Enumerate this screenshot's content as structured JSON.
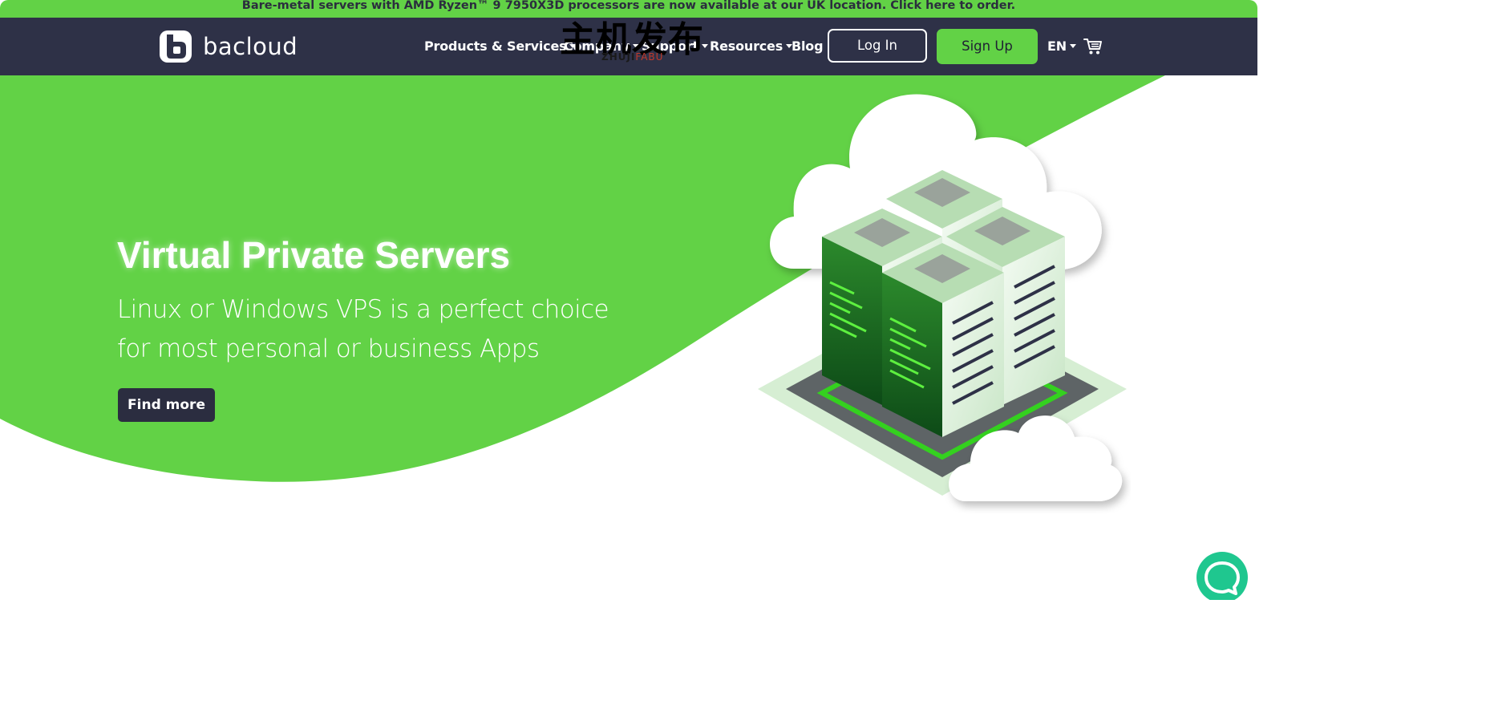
{
  "announcement": {
    "text": "Bare-metal servers with AMD Ryzen™ 9 7950X3D processors are now available at our UK location. Click here to order."
  },
  "brand": {
    "name": "bacloud",
    "accent_color": "#62d246",
    "nav_bg": "#2e3147"
  },
  "nav": {
    "items": [
      {
        "label": "Products & Services"
      },
      {
        "label": "Company"
      },
      {
        "label": "Support"
      },
      {
        "label": "Resources"
      },
      {
        "label": "Blog"
      }
    ],
    "login_label": "Log In",
    "signup_label": "Sign Up",
    "language": "EN",
    "cart_icon": "cart-icon"
  },
  "watermark": {
    "cn_text": "主机发布",
    "en_text_a": "ZHUJI",
    "en_text_b": "FABU"
  },
  "hero": {
    "title": "Virtual Private Servers",
    "subtitle_line1": "Linux or Windows VPS is a perfect choice",
    "subtitle_line2": "for most personal or business Apps",
    "cta_label": "Find more"
  },
  "chat": {
    "icon": "chat-bubble-icon",
    "color": "#1fc78f"
  }
}
